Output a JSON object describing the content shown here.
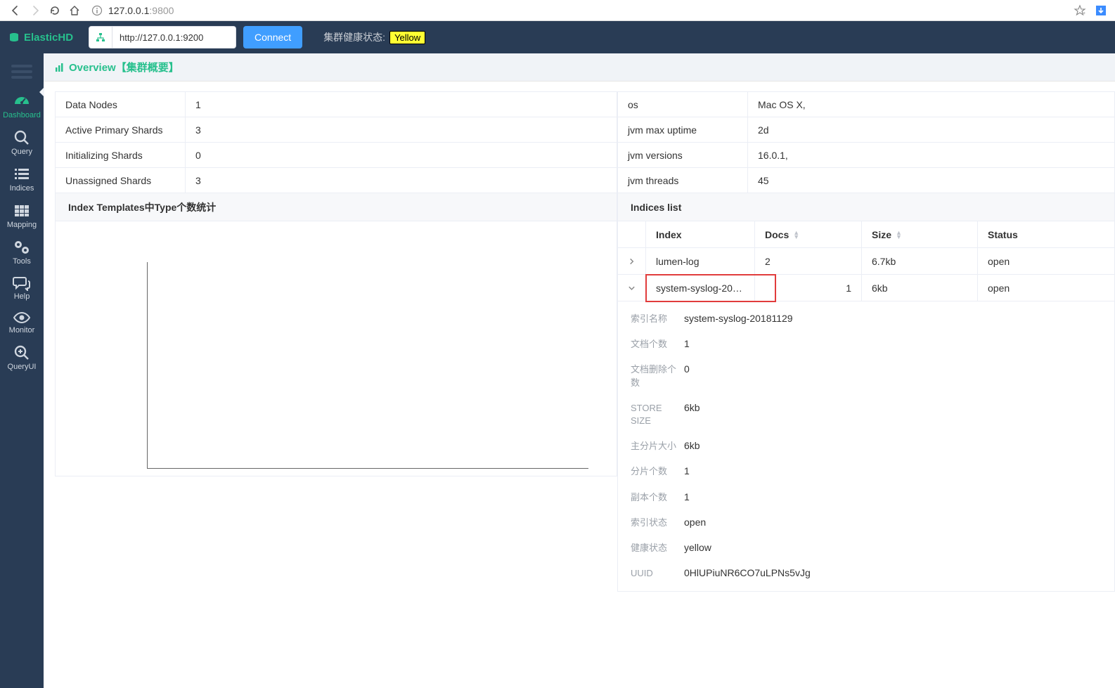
{
  "browser": {
    "url_main": "127.0.0.1",
    "url_port": ":9800"
  },
  "header": {
    "brand": "ElasticHD",
    "addr_input": "http://127.0.0.1:9200",
    "connect": "Connect",
    "health_label": "集群健康状态:",
    "health_value": "Yellow"
  },
  "sidebar": {
    "items": [
      {
        "label": "Dashboard"
      },
      {
        "label": "Query"
      },
      {
        "label": "Indices"
      },
      {
        "label": "Mapping"
      },
      {
        "label": "Tools"
      },
      {
        "label": "Help"
      },
      {
        "label": "Monitor"
      },
      {
        "label": "QueryUI"
      }
    ]
  },
  "overview_title": "Overview【集群概要】",
  "left_kv": [
    {
      "k": "Data Nodes",
      "v": "1"
    },
    {
      "k": "Active Primary Shards",
      "v": "3"
    },
    {
      "k": "Initializing Shards",
      "v": "0"
    },
    {
      "k": "Unassigned Shards",
      "v": "3"
    }
  ],
  "right_kv": [
    {
      "k": "os",
      "v": "Mac OS X,"
    },
    {
      "k": "jvm max uptime",
      "v": "2d"
    },
    {
      "k": "jvm versions",
      "v": "16.0.1,"
    },
    {
      "k": "jvm threads",
      "v": "45"
    }
  ],
  "left_section_title": "Index Templates中Type个数统计",
  "indices_section_title": "Indices list",
  "idx_headers": {
    "index": "Index",
    "docs": "Docs",
    "size": "Size",
    "status": "Status"
  },
  "idx_rows": [
    {
      "exp": "›",
      "index": "lumen-log",
      "docs": "2",
      "size": "6.7kb",
      "status": "open"
    },
    {
      "exp": "⌄",
      "index": "system-syslog-20…",
      "docs": "1",
      "size": "6kb",
      "status": "open"
    }
  ],
  "detail": [
    {
      "k": "索引名称",
      "v": "system-syslog-20181129"
    },
    {
      "k": "文档个数",
      "v": "1"
    },
    {
      "k": "文档删除个数",
      "v": "0"
    },
    {
      "k": "STORE SIZE",
      "v": "6kb"
    },
    {
      "k": "主分片大小",
      "v": "6kb"
    },
    {
      "k": "分片个数",
      "v": "1"
    },
    {
      "k": "副本个数",
      "v": "1"
    },
    {
      "k": "索引状态",
      "v": "open"
    },
    {
      "k": "健康状态",
      "v": "yellow"
    },
    {
      "k": "UUID",
      "v": "0HlUPiuNR6CO7uLPNs5vJg"
    }
  ]
}
